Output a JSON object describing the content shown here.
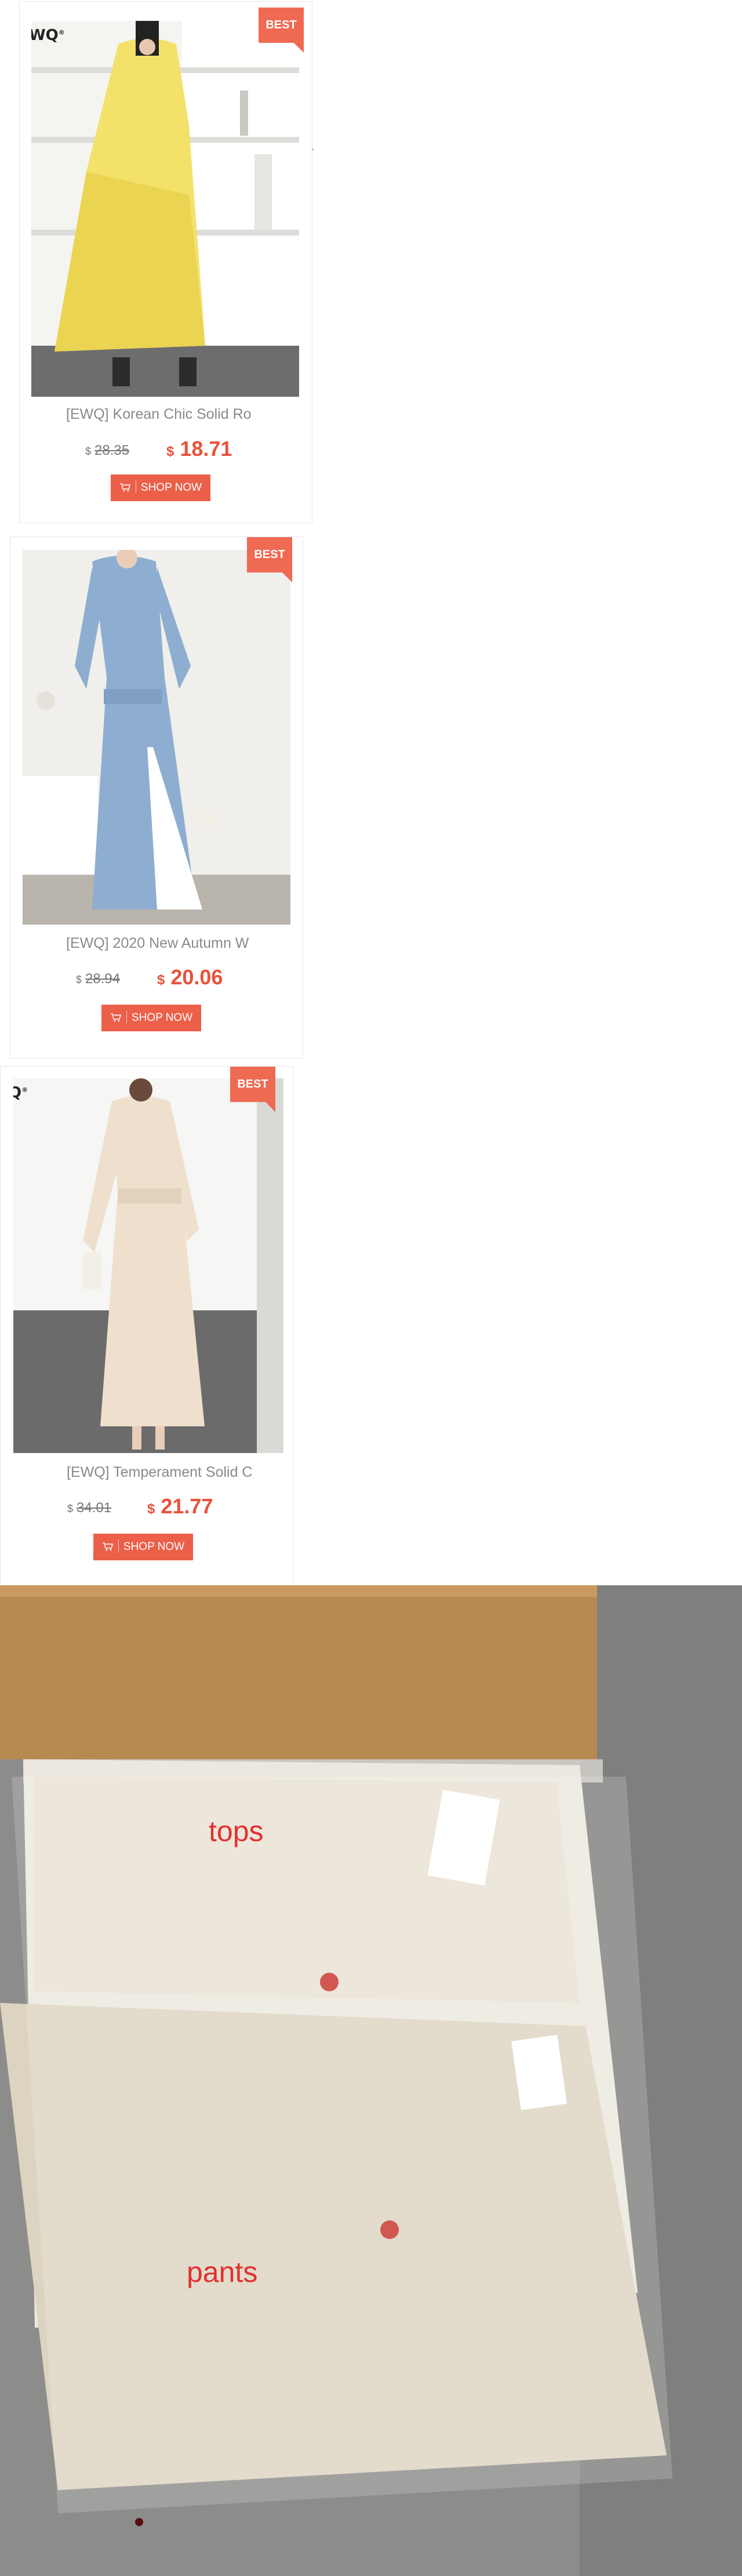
{
  "products": [
    {
      "badge": "BEST",
      "logo": "WQ",
      "title": "[EWQ] Korean Chic Solid Ro",
      "currency": "$",
      "old_price": "28.35",
      "new_price": "18.71",
      "cta": "SHOP NOW",
      "dress_color": "#f2e25a"
    },
    {
      "badge": "BEST",
      "title": "[EWQ]  2020 New Autumn W",
      "currency": "$",
      "old_price": "28.94",
      "new_price": "20.06",
      "cta": "SHOP NOW",
      "dress_color": "#8fb0d3"
    },
    {
      "badge": "BEST",
      "logo": "Q",
      "title": "[EWQ] Temperament Solid C",
      "currency": "$",
      "old_price": "34.01",
      "new_price": "21.77",
      "cta": "SHOP NOW",
      "dress_color": "#eee0cd"
    }
  ],
  "package": {
    "label_top": "tops",
    "label_bottom": "pants",
    "accent": "#e33030"
  }
}
